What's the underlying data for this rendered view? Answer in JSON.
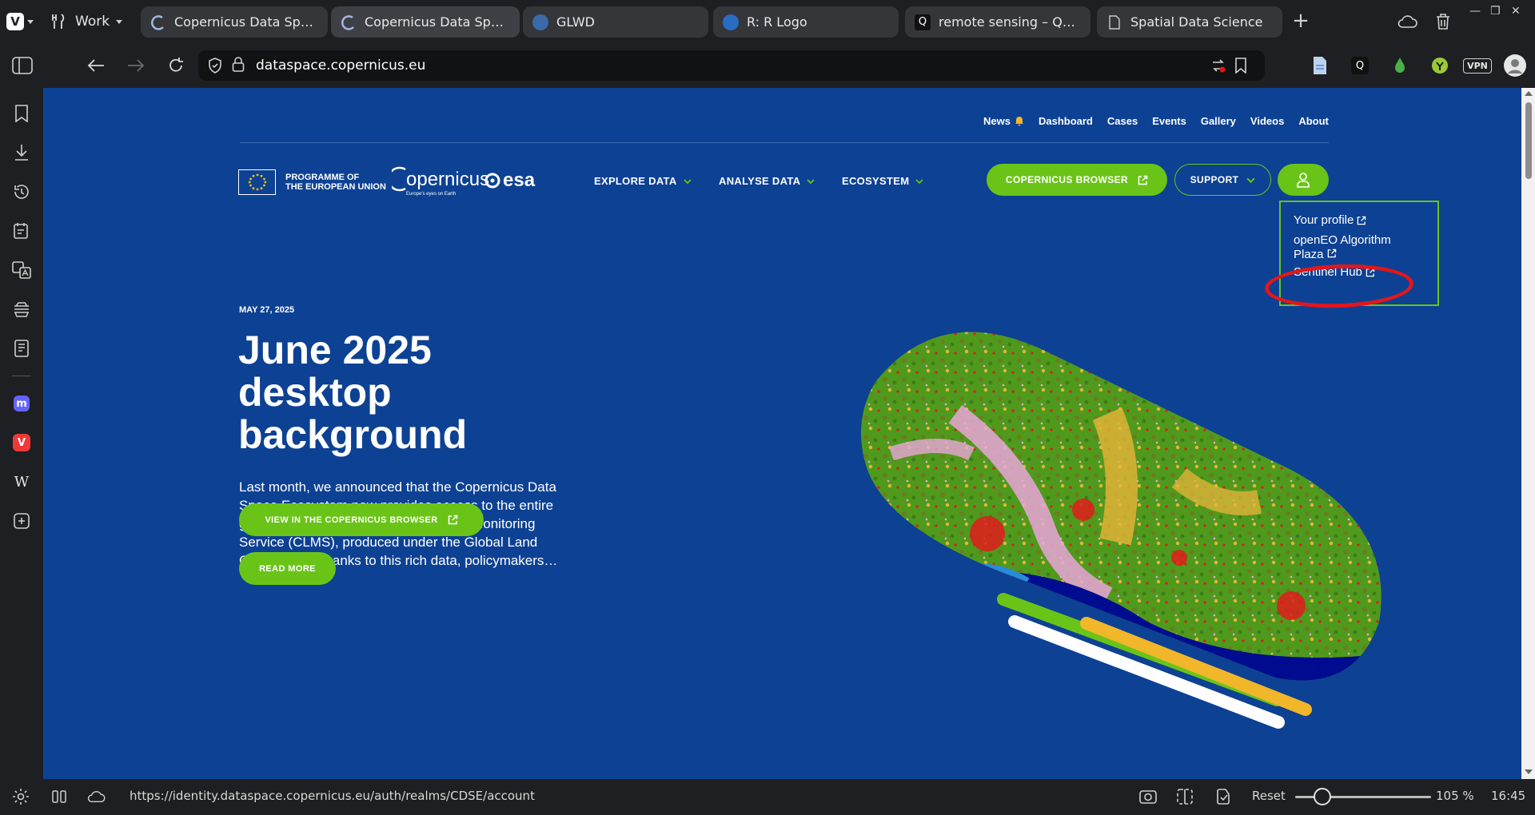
{
  "browser": {
    "workspace_label": "Work",
    "tabs": [
      {
        "title": "Copernicus Data Space E…",
        "active": false
      },
      {
        "title": "Copernicus Data Space Ecos",
        "active": true
      },
      {
        "title": "GLWD",
        "active": false
      },
      {
        "title": "R: R Logo",
        "active": false
      },
      {
        "title": "remote sensing – Qwant …",
        "active": false
      },
      {
        "title": "Spatial Data Science",
        "active": false
      }
    ],
    "url_prefix": "",
    "url_domain": "dataspace.copernicus.eu",
    "vpn_label": "VPN",
    "status_url": "https://identity.dataspace.copernicus.eu/auth/realms/CDSE/account",
    "reset_label": "Reset",
    "zoom": "105 %",
    "zoom_fraction": 0.2,
    "clock": "16:45"
  },
  "site": {
    "top_nav": [
      "News",
      "Dashboard",
      "Cases",
      "Events",
      "Gallery",
      "Videos",
      "About"
    ],
    "eu_line1": "PROGRAMME OF",
    "eu_line2": "THE EUROPEAN UNION",
    "copernicus_logo": "opernicus",
    "copernicus_tagline": "Europe's eyes on Earth",
    "esa_logo": "esa",
    "main_nav": {
      "explore": "EXPLORE DATA",
      "analyse": "ANALYSE DATA",
      "ecosystem": "ECOSYSTEM"
    },
    "browser_button": "COPERNICUS BROWSER",
    "support_button": "SUPPORT",
    "user_menu": {
      "profile": "Your profile",
      "openeo": "openEO Algorithm Plaza",
      "sentinel": "Sentinel Hub"
    },
    "article": {
      "date": "MAY 27, 2025",
      "title": "June 2025 desktop background",
      "body": "Last month, we announced that the Copernicus Data Space Ecosystem now provides access to the entire global dataset of the Copernicus Land Monitoring Service (CLMS), produced under the Global Land Component. Thanks to this rich data, policymakers…",
      "view_button": "VIEW IN THE COPERNICUS BROWSER",
      "read_more": "READ MORE"
    },
    "colors": {
      "background": "#0d4193",
      "accent_green": "#6ac418",
      "highlight_red": "#e3161b"
    }
  }
}
